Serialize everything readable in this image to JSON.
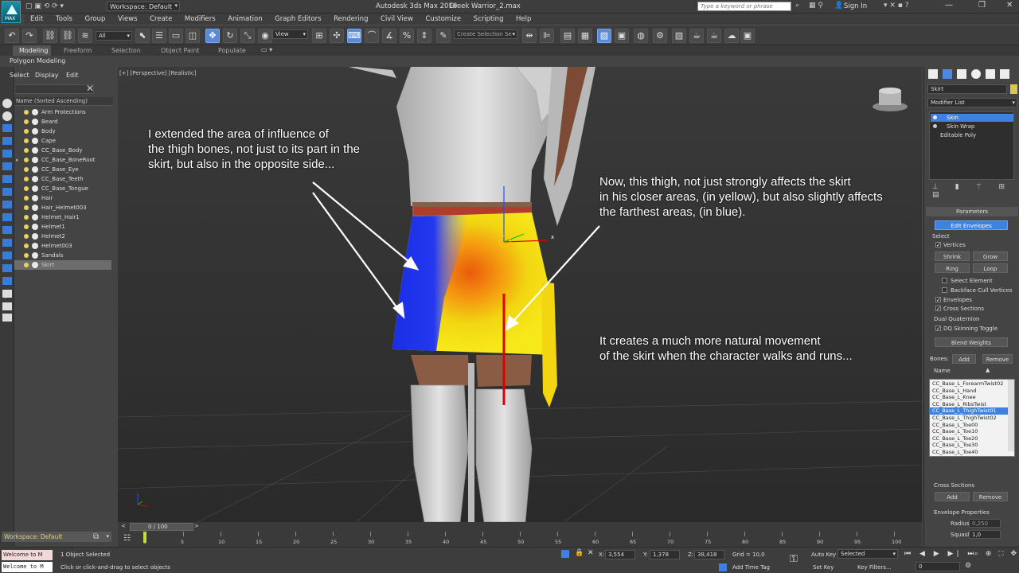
{
  "titlebar": {
    "app_logo": "MAX",
    "workspace": "Workspace: Default",
    "app_name": "Autodesk 3ds Max 2016",
    "file_name": "Greek Warrior_2.max",
    "search_placeholder": "Type a keyword or phrase",
    "signin": "Sign In"
  },
  "menu": [
    "Edit",
    "Tools",
    "Group",
    "Views",
    "Create",
    "Modifiers",
    "Animation",
    "Graph Editors",
    "Rendering",
    "Civil View",
    "Customize",
    "Scripting",
    "Help"
  ],
  "toolbar": {
    "filter_value": "All",
    "ref_coord": "View",
    "selection_set_placeholder": "Create Selection Se"
  },
  "ribbon": {
    "tabs": [
      "Modeling",
      "Freeform",
      "Selection",
      "Object Paint",
      "Populate"
    ],
    "sub": "Polygon Modeling"
  },
  "scene_explorer": {
    "menu": [
      "Select",
      "Display",
      "Edit"
    ],
    "header": "Name (Sorted Ascending)",
    "items": [
      "Arm Protections",
      "Beard",
      "Body",
      "Cape",
      "CC_Base_Body",
      "CC_Base_BoneRoot",
      "CC_Base_Eye",
      "CC_Base_Teeth",
      "CC_Base_Tongue",
      "Hair",
      "Hair_Helmet003",
      "Helmet_Hair1",
      "Helmet1",
      "Helmet2",
      "Helmet003",
      "Sandals",
      "Skirt"
    ],
    "workspace": "Workspace: Default"
  },
  "viewport": {
    "label": "[+] [Perspective] [Realistic]",
    "gizmo_x": "x"
  },
  "annotations": {
    "a1": [
      "I extended the area of influence of",
      "the thigh bones, not just to its part in the",
      "skirt, but also in the opposite side..."
    ],
    "a2": [
      "Now, this thigh, not just strongly affects the skirt",
      "in his closer areas, (in yellow), but also slightly affects",
      "the farthest areas, (in blue)."
    ],
    "a3": [
      "It creates a much more natural movement",
      "of the skirt when the character walks and runs..."
    ]
  },
  "command_panel": {
    "object_name": "Skirt",
    "modifier_list": "Modifier List",
    "stack": [
      "Skin",
      "Skin Wrap",
      "Editable Poly"
    ],
    "rollout_parameters": "Parameters",
    "edit_envelopes": "Edit Envelopes",
    "select_group": "Select",
    "vertices": "Vertices",
    "shrink": "Shrink",
    "grow": "Grow",
    "ring": "Ring",
    "loop": "Loop",
    "select_element": "Select Element",
    "backface": "Backface Cull Vertices",
    "envelopes": "Envelopes",
    "cross_sections": "Cross Sections",
    "dual_quaternion": "Dual Quaternion",
    "dq_toggle": "DQ Skinning Toggle",
    "blend_weights": "Blend Weights",
    "bones_label": "Bones:",
    "add": "Add",
    "remove": "Remove",
    "name_header": "Name",
    "bones": [
      "CC_Base_L_ForearmTwist02",
      "CC_Base_L_Hand",
      "CC_Base_L_Knee",
      "CC_Base_L_RibsTwist",
      "CC_Base_L_ThighTwist01",
      "CC_Base_L_ThighTwist02",
      "CC_Base_L_Toe00",
      "CC_Base_L_Toe10",
      "CC_Base_L_Toe20",
      "CC_Base_L_Toe30",
      "CC_Base_L_Toe40"
    ],
    "selected_bone": "CC_Base_L_ThighTwist01",
    "cross_sections_title": "Cross Sections",
    "cs_add": "Add",
    "cs_remove": "Remove",
    "envelope_props": "Envelope Properties",
    "radius_label": "Radius:",
    "radius_value": "0,250",
    "squash_label": "Squash:",
    "squash_value": "1,0"
  },
  "timeline": {
    "frame": "0 / 100",
    "ticks": [
      "0",
      "5",
      "10",
      "15",
      "20",
      "25",
      "30",
      "35",
      "40",
      "45",
      "50",
      "55",
      "60",
      "65",
      "70",
      "75",
      "80",
      "85",
      "90",
      "95",
      "100"
    ]
  },
  "status": {
    "maxscript": "Welcome to M",
    "selected": "1 Object Selected",
    "prompt": "Click or click-and-drag to select objects",
    "x_label": "X:",
    "x_value": "3,554",
    "y_label": "Y:",
    "y_value": "1,378",
    "z_label": "Z:",
    "z_value": "38,418",
    "grid": "Grid = 10,0",
    "add_time_tag": "Add Time Tag",
    "auto_key": "Auto Key",
    "auto_key_value": "Selected",
    "set_key": "Set Key",
    "key_filters": "Key Filters...",
    "frame_value": "0"
  },
  "colors": {
    "accent": "#5a8ad6",
    "skirt_blue": "#1a2ee6",
    "skirt_yellow": "#f2d612",
    "skirt_orange": "#ea5a0c",
    "bone_red": "#e00000"
  }
}
